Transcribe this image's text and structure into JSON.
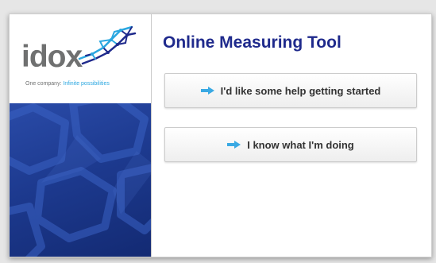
{
  "brand": {
    "logo_text": "idox",
    "tagline_part1": "One company: ",
    "tagline_part2": "Infinite possibilities",
    "accent_color": "#2aa7e0",
    "panel_color": "#1d3a8f"
  },
  "main": {
    "title": "Online Measuring Tool",
    "title_color": "#1f2a8c",
    "buttons": [
      {
        "label": "I'd like some help getting started",
        "icon": "arrow-right-icon"
      },
      {
        "label": "I know what I'm doing",
        "icon": "arrow-right-icon"
      }
    ]
  }
}
